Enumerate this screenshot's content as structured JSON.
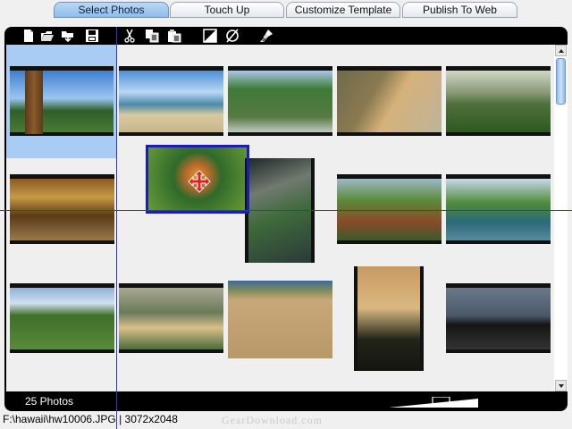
{
  "tabs": [
    {
      "label": "Select Photos",
      "active": true
    },
    {
      "label": "Touch Up",
      "active": false
    },
    {
      "label": "Customize Template",
      "active": false
    },
    {
      "label": "Publish To Web",
      "active": false
    }
  ],
  "toolbar": {
    "icons": [
      "new-document-icon",
      "open-folder-icon",
      "import-folder-icon",
      "save-icon",
      "cut-icon",
      "copy-icon",
      "paste-icon",
      "contrast-icon",
      "clear-icon",
      "clean-brush-icon"
    ]
  },
  "photos": [
    {
      "name": "tiki-statue-coast",
      "colors": [
        "#3f7fd0",
        "#7d6a3a",
        "#2f5f2a"
      ]
    },
    {
      "name": "beach-shoreline",
      "colors": [
        "#4d8fd8",
        "#d9c9a2",
        "#4a8aa8"
      ]
    },
    {
      "name": "green-valley",
      "colors": [
        "#a9c8e8",
        "#3f7a37",
        "#567a42"
      ]
    },
    {
      "name": "cliffs-sunset-beach",
      "colors": [
        "#d6b27a",
        "#6f6a4a",
        "#bdb39a"
      ]
    },
    {
      "name": "hazy-mountain-ridge",
      "colors": [
        "#cfd8c4",
        "#4f6f3a",
        "#2d5a22"
      ]
    },
    {
      "name": "golden-sunset-sea",
      "colors": [
        "#c79a46",
        "#8a5c22",
        "#5a3a18"
      ]
    },
    {
      "name": "bird-of-paradise-flower",
      "colors": [
        "#2f6a2a",
        "#d9a12a",
        "#6a9a3a"
      ]
    },
    {
      "name": "helicopter-view-cliffs",
      "colors": [
        "#707a70",
        "#3f6a3a",
        "#1f2a2a"
      ]
    },
    {
      "name": "na-pali-ridges",
      "colors": [
        "#9fb8c8",
        "#5a8a3a",
        "#8a4a2a"
      ]
    },
    {
      "name": "coastline-surf",
      "colors": [
        "#c8d8e8",
        "#4f8a3a",
        "#2a6a7a"
      ]
    },
    {
      "name": "valley-lookout",
      "colors": [
        "#8fb0d8",
        "#3f6f2a",
        "#5a8a3a"
      ]
    },
    {
      "name": "bay-beach-homes",
      "colors": [
        "#a8a890",
        "#d8c08a",
        "#4a6a3a"
      ]
    },
    {
      "name": "sandy-beach-people",
      "colors": [
        "#3a6aa0",
        "#c8a878",
        "#b89868"
      ]
    },
    {
      "name": "palm-silhouette-sunset",
      "colors": [
        "#d9b880",
        "#222418",
        "#c89a60"
      ]
    },
    {
      "name": "palm-reflection-pond",
      "colors": [
        "#4a5a6a",
        "#151515",
        "#6a7888"
      ]
    }
  ],
  "bottom": {
    "count": "25 Photos"
  },
  "status": {
    "text": "F:\\hawaii\\hw10006.JPG | 3072x2048"
  },
  "watermark": "GearDownload.com",
  "colors": {
    "accent": "#1b1fb0",
    "selection": "#a8ccf3",
    "guide": "#2a3bd4"
  }
}
